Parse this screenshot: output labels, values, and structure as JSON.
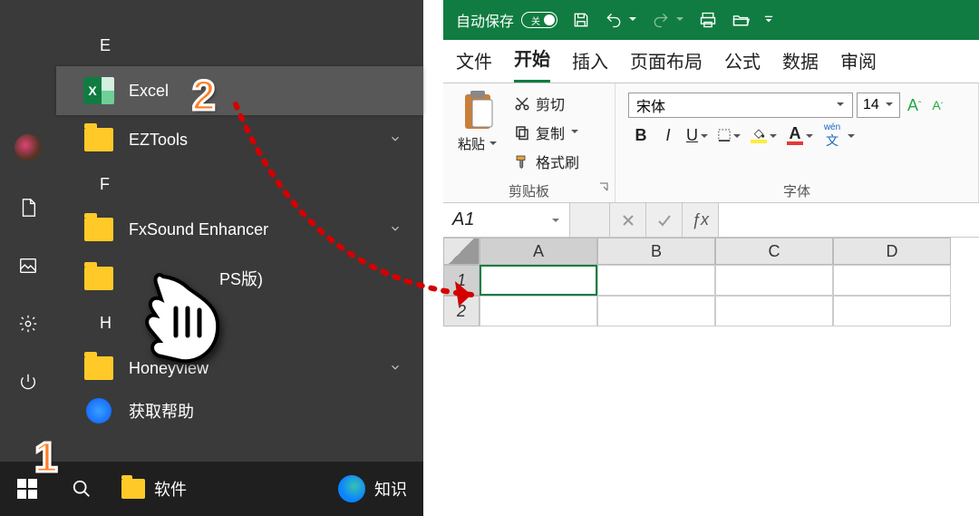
{
  "annotations": {
    "step1": "1",
    "step2": "2"
  },
  "startmenu": {
    "letters": {
      "e": "E",
      "f": "F",
      "h": "H"
    },
    "items": {
      "excel": "Excel",
      "eztools": "EZTools",
      "fxsound": "FxSound Enhancer",
      "wps_partial": "PS版)",
      "honeyview": "Honeyview",
      "gethelp": "获取帮助"
    }
  },
  "taskbar": {
    "app1": "软件",
    "app2": "知识"
  },
  "excel": {
    "titlebar": {
      "autosave": "自动保存",
      "toggle_label": "关"
    },
    "tabs": {
      "file": "文件",
      "home": "开始",
      "insert": "插入",
      "layout": "页面布局",
      "formulas": "公式",
      "data": "数据",
      "review": "审阅"
    },
    "clipboard": {
      "paste": "粘贴",
      "cut": "剪切",
      "copy": "复制",
      "format_painter": "格式刷",
      "group": "剪贴板"
    },
    "font": {
      "name": "宋体",
      "size": "14",
      "group": "字体",
      "wen": "wén",
      "bold": "B",
      "italic": "I",
      "underline": "U",
      "letterA": "A"
    },
    "namebox": "A1",
    "columns": {
      "a": "A",
      "b": "B",
      "c": "C",
      "d": "D"
    },
    "rows": {
      "r1": "1",
      "r2": "2"
    }
  }
}
